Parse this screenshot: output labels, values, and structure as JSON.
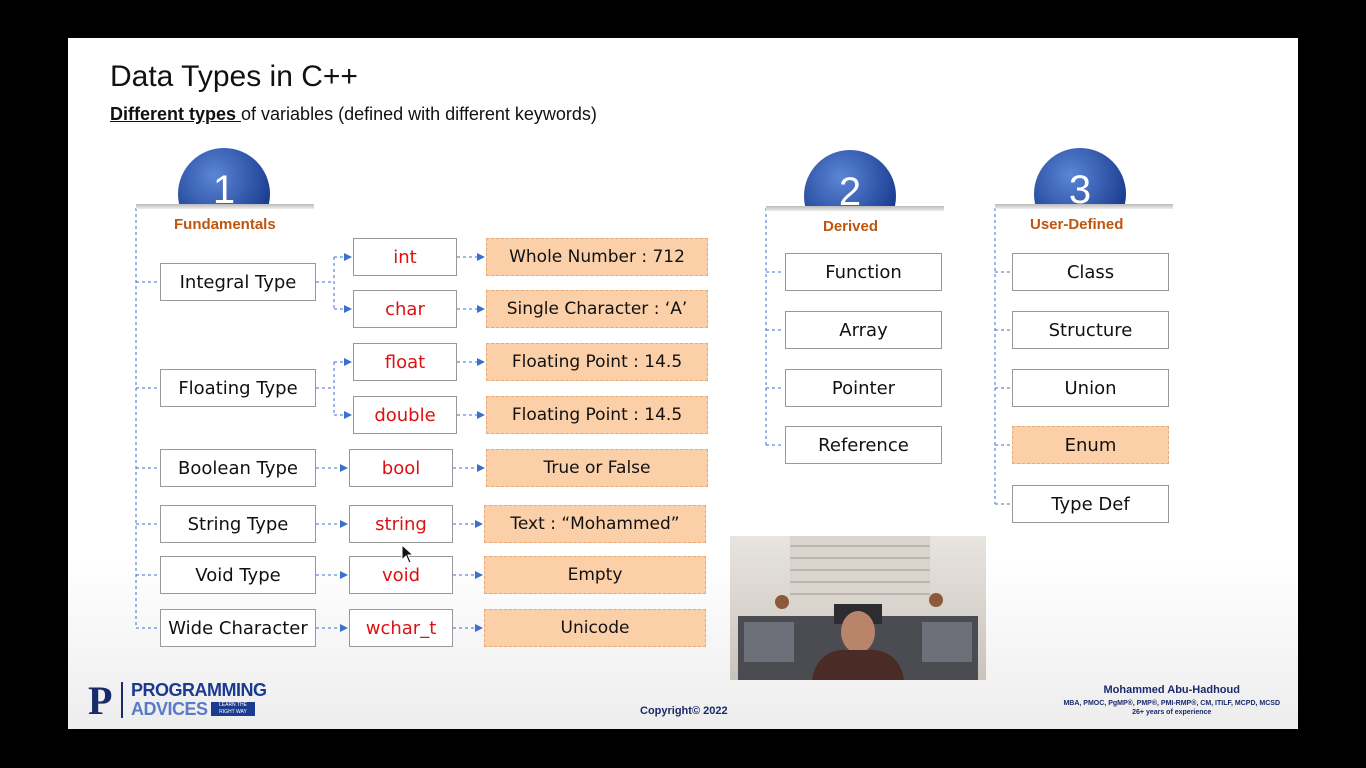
{
  "slide": {
    "title": "Data Types in C++",
    "subtitle_bold": "Different types ",
    "subtitle_rest": "of variables (defined with different keywords)"
  },
  "fundamentals": {
    "number": "1",
    "label": "Fundamentals",
    "groups": [
      {
        "name": "Integral Type",
        "items": [
          {
            "keyword": "int",
            "value": "Whole Number : 712"
          },
          {
            "keyword": "char",
            "value": "Single Character : ‘A’"
          }
        ]
      },
      {
        "name": "Floating Type",
        "items": [
          {
            "keyword": "float",
            "value": "Floating Point : 14.5"
          },
          {
            "keyword": "double",
            "value": "Floating Point : 14.5"
          }
        ]
      },
      {
        "name": "Boolean Type",
        "items": [
          {
            "keyword": "bool",
            "value": "True or False"
          }
        ]
      },
      {
        "name": "String Type",
        "items": [
          {
            "keyword": "string",
            "value": "Text : “Mohammed”"
          }
        ]
      },
      {
        "name": "Void Type",
        "items": [
          {
            "keyword": "void",
            "value": "Empty"
          }
        ]
      },
      {
        "name": "Wide Character",
        "items": [
          {
            "keyword": "wchar_t",
            "value": "Unicode"
          }
        ]
      }
    ]
  },
  "derived": {
    "number": "2",
    "label": "Derived",
    "items": [
      "Function",
      "Array",
      "Pointer",
      "Reference"
    ]
  },
  "user_defined": {
    "number": "3",
    "label": "User-Defined",
    "items": [
      "Class",
      "Structure",
      "Union",
      "Enum",
      "Type Def"
    ],
    "highlighted": "Enum"
  },
  "footer": {
    "logo_line1": "PROGRAMMING",
    "logo_line2": "ADVICES",
    "logo_tag": "LEARN THE RIGHT WAY",
    "copyright": "Copyright© 2022",
    "author_name": "Mohammed Abu-Hadhoud",
    "author_certs": "MBA, PMOC, PgMP®, PMP®, PMI-RMP®, CM, ITILF, MCPD, MCSD",
    "author_experience": "26+ years of experience"
  },
  "colors": {
    "badge": "#1b3d91",
    "category": "#c0560e",
    "keyword": "#dd1111",
    "value_fill": "#fbd0a9",
    "connector": "#3a6fd0"
  }
}
